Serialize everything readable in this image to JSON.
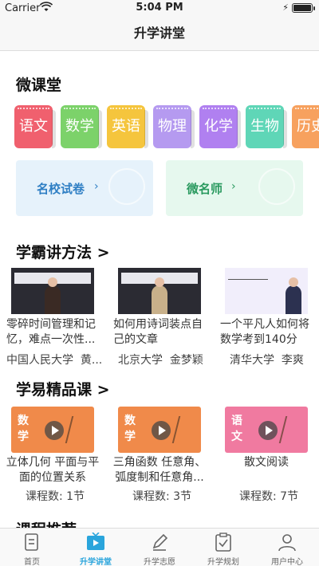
{
  "status": {
    "carrier": "Carrier",
    "time": "5:04 PM"
  },
  "nav": {
    "title": "升学讲堂"
  },
  "micro": {
    "title": "微课堂",
    "subjects": [
      {
        "label": "语文",
        "color": "#f0606e"
      },
      {
        "label": "数学",
        "color": "#7cd26a"
      },
      {
        "label": "英语",
        "color": "#f5c53d"
      },
      {
        "label": "物理",
        "color": "#b59af0"
      },
      {
        "label": "化学",
        "color": "#b080f0"
      },
      {
        "label": "生物",
        "color": "#5fd6b7"
      },
      {
        "label": "历史",
        "color": "#f7a15e"
      }
    ],
    "cards": [
      {
        "label": "名校试卷",
        "chevron": "›",
        "bg": "#e6f2fb",
        "fg": "#2f7fc4"
      },
      {
        "label": "微名师",
        "chevron": "›",
        "bg": "#e6f8ee",
        "fg": "#2a9a5f"
      }
    ]
  },
  "methods": {
    "title": "学霸讲方法 >",
    "videos": [
      {
        "title": "零碎时间管理和记忆，难点一次性...",
        "school": "中国人民大学",
        "teacher": "黄..."
      },
      {
        "title": "如何用诗词装点自己的文章",
        "school": "北京大学",
        "teacher": "金梦颖"
      },
      {
        "title": "一个平凡人如何将数学考到140分",
        "school": "清华大学",
        "teacher": "李爽"
      }
    ]
  },
  "courses": {
    "title": "学易精品课 >",
    "items": [
      {
        "tag": "数学",
        "title": "立体几何 平面与平面的位置关系",
        "count": "课程数: 1节",
        "color": "#f08a4a"
      },
      {
        "tag": "数学",
        "title": "三角函数 任意角、弧度制和任意角...",
        "count": "课程数: 3节",
        "color": "#f08a4a"
      },
      {
        "tag": "语文",
        "title": "散文阅读",
        "count": "课程数: 7节",
        "color": "#f07aa0"
      }
    ]
  },
  "next_section": {
    "title": "课程推荐"
  },
  "tabs": [
    {
      "label": "首页",
      "icon": "home-doc-icon",
      "active": false
    },
    {
      "label": "升学讲堂",
      "icon": "play-tv-icon",
      "active": true
    },
    {
      "label": "升学志愿",
      "icon": "pencil-icon",
      "active": false
    },
    {
      "label": "升学规划",
      "icon": "clipboard-check-icon",
      "active": false
    },
    {
      "label": "用户中心",
      "icon": "user-icon",
      "active": false
    }
  ],
  "colors": {
    "accent": "#2aa5dc",
    "tab_inactive": "#666666"
  }
}
